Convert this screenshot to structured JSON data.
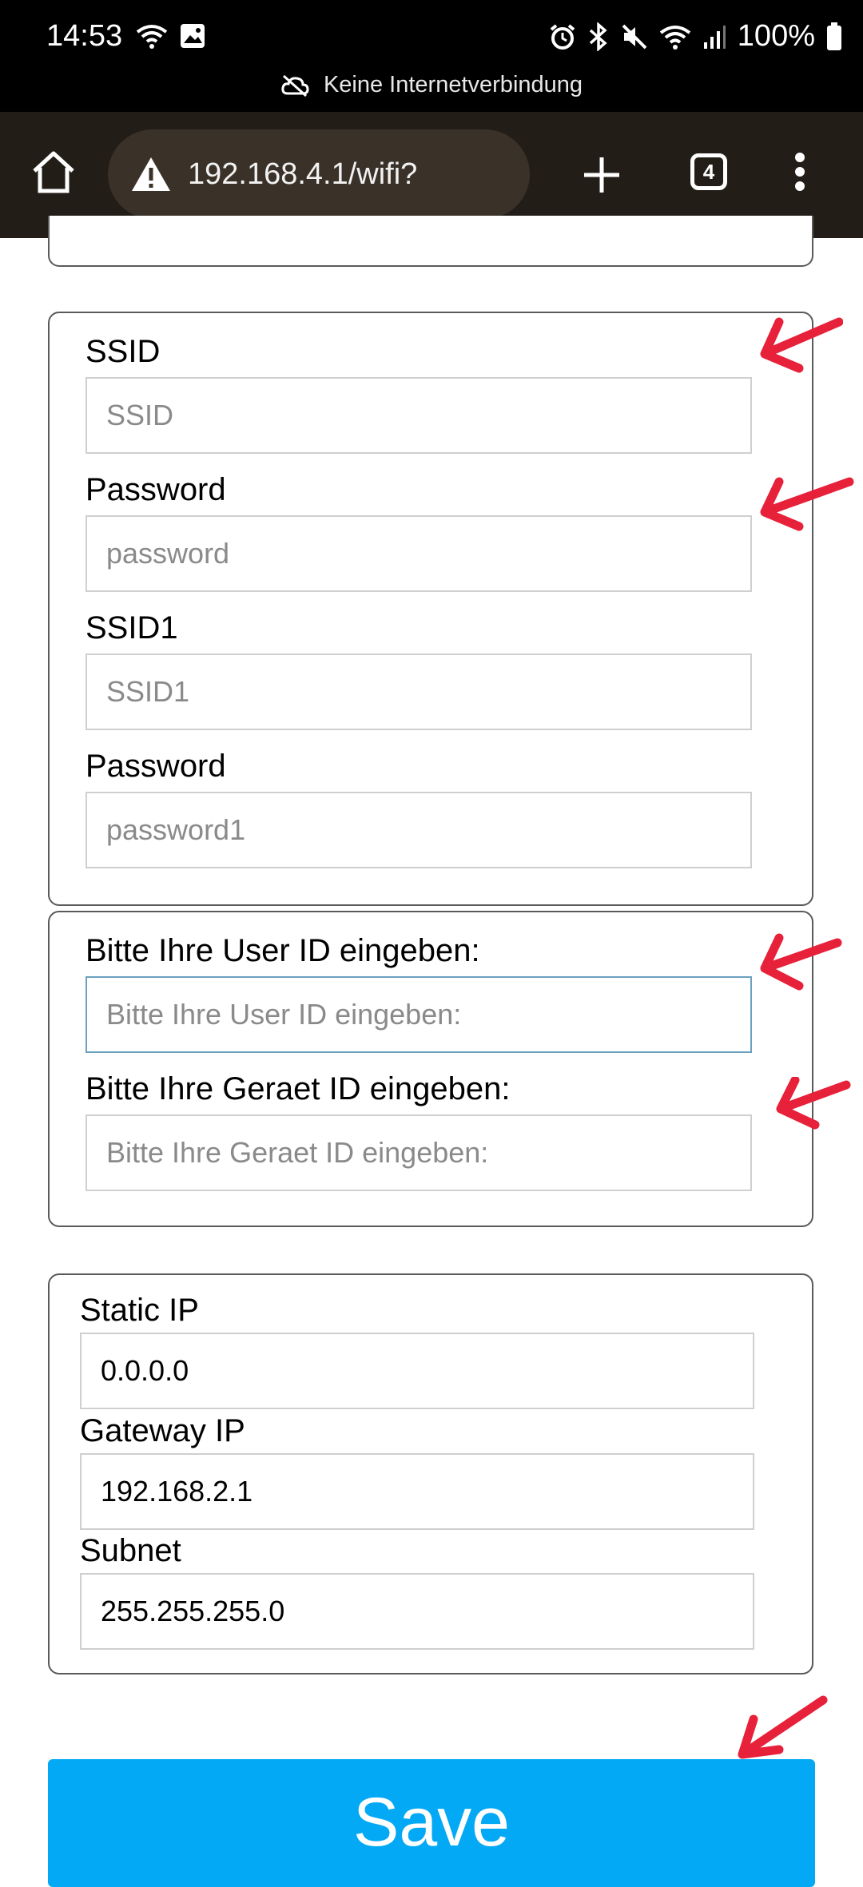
{
  "status_bar": {
    "time": "14:53",
    "battery": "100%",
    "connectivity_notice": "Keine Internetverbindung"
  },
  "browser": {
    "url": "192.168.4.1/wifi?",
    "tab_count": "4"
  },
  "wifi_section": {
    "ssid_label": "SSID",
    "ssid_placeholder": "SSID",
    "password_label": "Password",
    "password_placeholder": "password",
    "ssid1_label": "SSID1",
    "ssid1_placeholder": "SSID1",
    "password1_label": "Password",
    "password1_placeholder": "password1"
  },
  "id_section": {
    "user_id_label": "Bitte Ihre User ID eingeben:",
    "user_id_placeholder": "Bitte Ihre User ID eingeben:",
    "device_id_label": "Bitte Ihre Geraet ID eingeben:",
    "device_id_placeholder": "Bitte Ihre Geraet ID eingeben:"
  },
  "ip_section": {
    "static_ip_label": "Static IP",
    "static_ip_value": "0.0.0.0",
    "gateway_label": "Gateway IP",
    "gateway_value": "192.168.2.1",
    "subnet_label": "Subnet",
    "subnet_value": "255.255.255.0"
  },
  "save_label": "Save",
  "colors": {
    "status_bar_bg": "#000000",
    "toolbar_bg": "#231d17",
    "save_button": "#03a9f4",
    "annotation_arrow": "#e8213a"
  }
}
